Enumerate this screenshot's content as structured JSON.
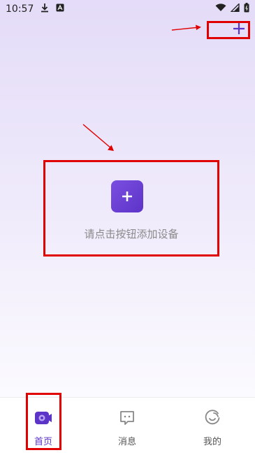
{
  "status_bar": {
    "time": "10:57"
  },
  "empty_state": {
    "hint": "请点击按钮添加设备"
  },
  "tabs": [
    {
      "label": "首页",
      "icon": "camera-icon",
      "active": true
    },
    {
      "label": "消息",
      "icon": "message-icon",
      "active": false
    },
    {
      "label": "我的",
      "icon": "profile-icon",
      "active": false
    }
  ],
  "colors": {
    "accent": "#5d34c8",
    "highlight": "#e00000"
  }
}
